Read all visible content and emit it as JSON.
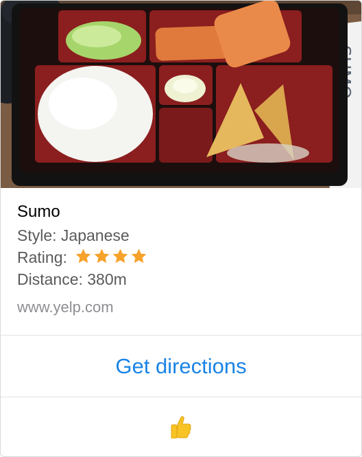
{
  "place": {
    "name": "Sumo",
    "style": "Style: Japanese",
    "rating_label": "Rating:",
    "rating_stars": 4,
    "distance": "Distance: 380m",
    "source": "www.yelp.com"
  },
  "actions": {
    "directions_label": "Get directions",
    "thumbs_icon": "thumbs-up-icon"
  },
  "colors": {
    "link_blue": "#1a84e6",
    "star": "#f7a22b",
    "thumb": "#f7c325"
  }
}
